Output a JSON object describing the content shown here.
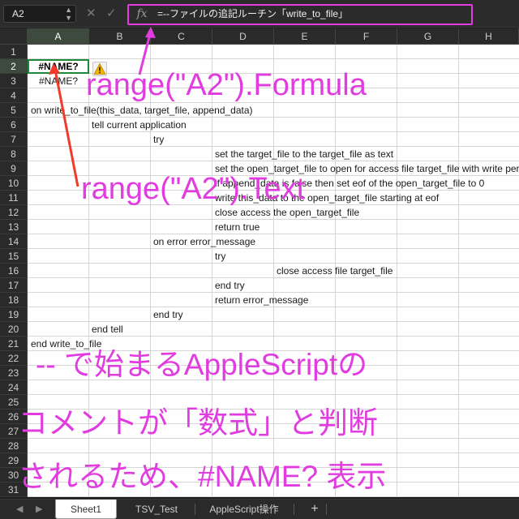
{
  "formula_bar": {
    "name_box": "A2",
    "fx": "fx",
    "formula": "=--ファイルの追記ルーチン「write_to_file」",
    "cancel_icon": "x-icon",
    "confirm_icon": "check-icon"
  },
  "columns": [
    "A",
    "B",
    "C",
    "D",
    "E",
    "F",
    "G",
    "H"
  ],
  "rows": [
    "1",
    "2",
    "3",
    "4",
    "5",
    "6",
    "7",
    "8",
    "9",
    "10",
    "11",
    "12",
    "13",
    "14",
    "15",
    "16",
    "17",
    "18",
    "19",
    "20",
    "21",
    "22",
    "23",
    "24",
    "25",
    "26",
    "27",
    "28",
    "29",
    "30",
    "31"
  ],
  "cells": {
    "a2": "#NAME?",
    "a3": "#NAME?",
    "r5": "on write_to_file(this_data, target_file, append_data)",
    "r6": "tell current application",
    "r7": "try",
    "r8": "set the target_file to the target_file as text",
    "r9": "set the open_target_file to open for access file target_file with write permission",
    "r10": "if append_data is false then set eof of the open_target_file to 0",
    "r11": "write this_data to the open_target_file starting at eof",
    "r12": "close access the open_target_file",
    "r13": "return true",
    "r14": "on error error_message",
    "r15": "try",
    "r16": "close access file target_file",
    "r17": "end try",
    "r18": "return error_message",
    "r19": "end try",
    "r20": "end tell",
    "r21": "end write_to_file"
  },
  "annotations": {
    "formula": "range(\"A2\").Formula",
    "text": "range(\"A2\").Text",
    "note_line1": "-- で始まるAppleScriptの",
    "note_line2": "コメントが「数式」と判断",
    "note_line3": "されるため、#NAME? 表示"
  },
  "sheet_tabs": [
    "Sheet1",
    "TSV_Test",
    "AppleScript操作"
  ],
  "active_tab": "Sheet1",
  "colors": {
    "annotation": "#e13ce0",
    "selection": "#1d8a3a"
  }
}
